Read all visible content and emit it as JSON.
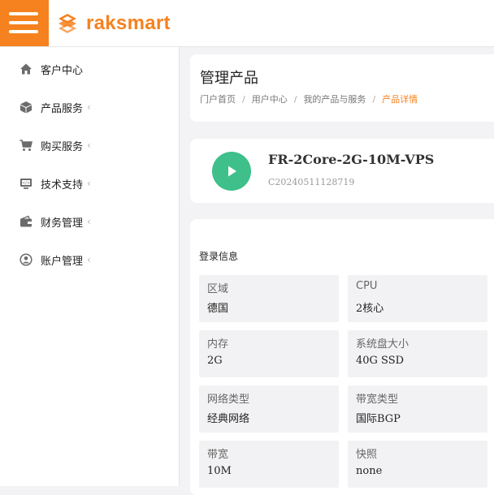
{
  "brand": {
    "name": "raksmart",
    "accent": "#f5821f"
  },
  "sidebar": {
    "items": [
      {
        "label": "客户中心",
        "icon": "home-icon",
        "has_caret": false
      },
      {
        "label": "产品服务",
        "icon": "box-icon",
        "has_caret": true
      },
      {
        "label": "购买服务",
        "icon": "cart-icon",
        "has_caret": true
      },
      {
        "label": "技术支持",
        "icon": "monitor-icon",
        "has_caret": true
      },
      {
        "label": "财务管理",
        "icon": "wallet-icon",
        "has_caret": true
      },
      {
        "label": "账户管理",
        "icon": "user-circle-icon",
        "has_caret": true
      }
    ]
  },
  "page": {
    "title": "管理产品",
    "breadcrumb": [
      "门户首页",
      "用户中心",
      "我的产品与服务",
      "产品详情"
    ]
  },
  "product": {
    "name": "FR-2Core-2G-10M-VPS",
    "id": "C20240511128719",
    "status_color": "#3fbf8a"
  },
  "login_info": {
    "title": "登录信息",
    "fields": [
      {
        "label": "区域",
        "value": "德国"
      },
      {
        "label": "CPU",
        "value": "2核心"
      },
      {
        "label": "内存",
        "value": "2G"
      },
      {
        "label": "系统盘大小",
        "value": "40G SSD"
      },
      {
        "label": "网络类型",
        "value": "经典网络"
      },
      {
        "label": "带宽类型",
        "value": "国际BGP"
      },
      {
        "label": "带宽",
        "value": "10M"
      },
      {
        "label": "快照",
        "value": "none"
      }
    ]
  }
}
